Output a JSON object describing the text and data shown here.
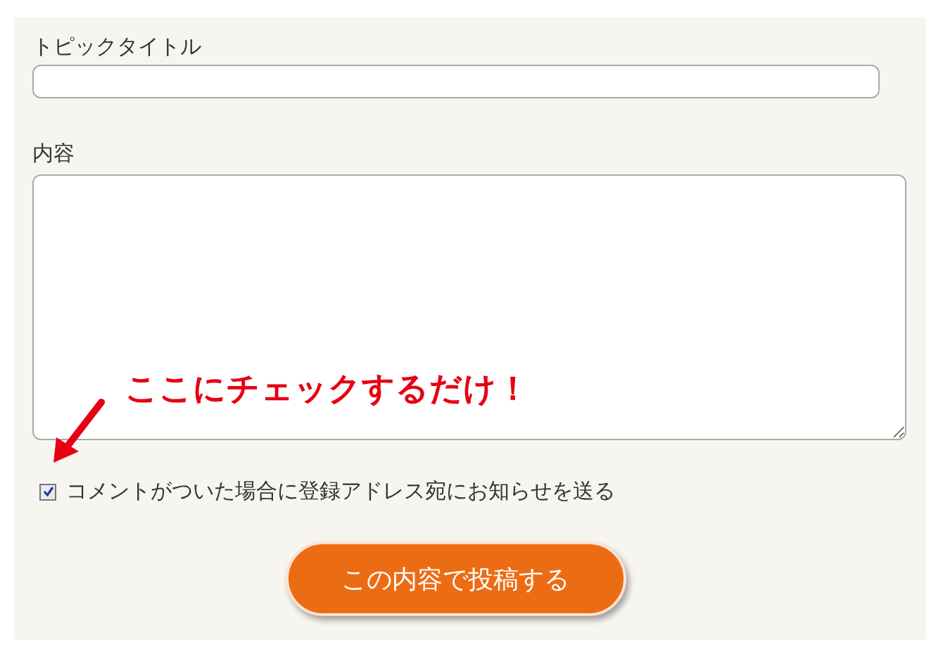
{
  "topic_title": {
    "label": "トピックタイトル"
  },
  "content": {
    "label": "内容"
  },
  "annotation": {
    "text": "ここにチェックするだけ！"
  },
  "notify": {
    "label": "コメントがついた場合に登録アドレス宛にお知らせを送る",
    "checked": true
  },
  "submit": {
    "label": "この内容で投稿する"
  }
}
